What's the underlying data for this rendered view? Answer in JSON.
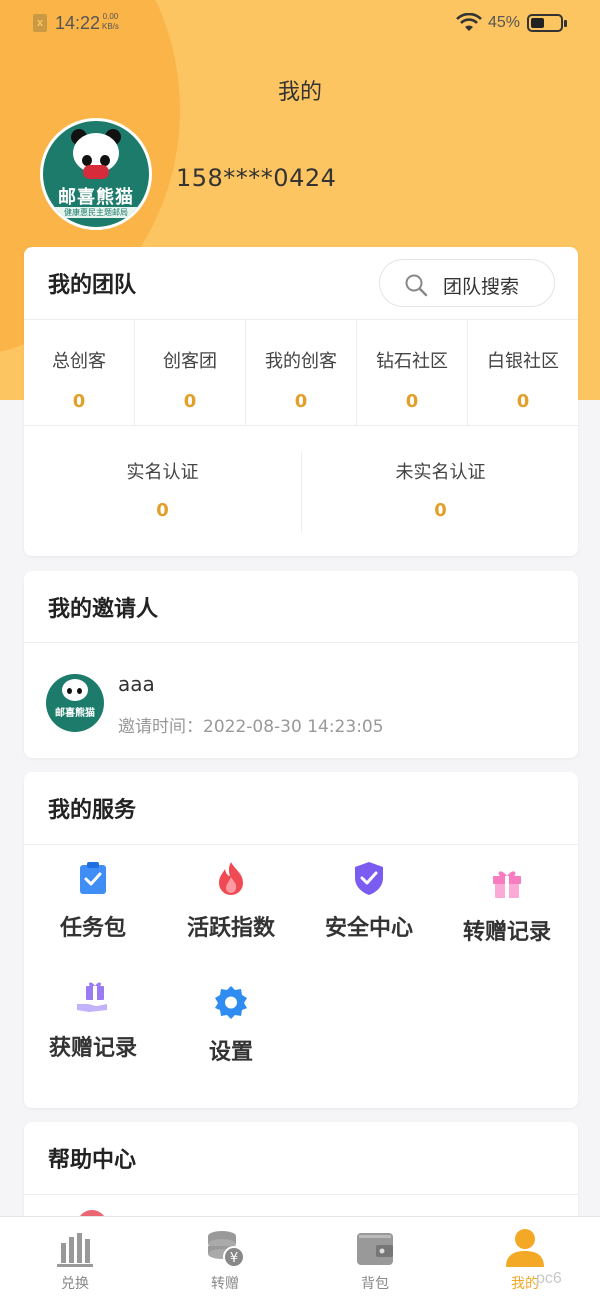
{
  "status_bar": {
    "time": "14:22",
    "speed_value": "0.00",
    "speed_unit": "KB/s",
    "battery": "45%",
    "battery_level": 0.45
  },
  "header": {
    "title": "我的",
    "phone": "158****0424"
  },
  "logo": {
    "name": "邮喜熊猫",
    "tagline": "健康惠民主题邮局",
    "badge": "SCENE"
  },
  "team": {
    "title": "我的团队",
    "search_label": "团队搜索",
    "stats": [
      {
        "label": "总创客",
        "value": "0"
      },
      {
        "label": "创客团",
        "value": "0"
      },
      {
        "label": "我的创客",
        "value": "0"
      },
      {
        "label": "钻石社区",
        "value": "0"
      },
      {
        "label": "白银社区",
        "value": "0"
      }
    ],
    "verify": [
      {
        "label": "实名认证",
        "value": "0"
      },
      {
        "label": "未实名认证",
        "value": "0"
      }
    ]
  },
  "inviter": {
    "title": "我的邀请人",
    "name": "aaa",
    "time": "邀请时间：2022-08-30 14:23:05"
  },
  "services": {
    "title": "我的服务",
    "items": [
      {
        "label": "任务包",
        "icon": "clipboard-icon"
      },
      {
        "label": "活跃指数",
        "icon": "fire-icon"
      },
      {
        "label": "安全中心",
        "icon": "shield-icon"
      },
      {
        "label": "转赠记录",
        "icon": "gift-icon"
      },
      {
        "label": "获赠记录",
        "icon": "gift-hand-icon"
      },
      {
        "label": "设置",
        "icon": "gear-icon"
      }
    ]
  },
  "help": {
    "title": "帮助中心"
  },
  "tabbar": {
    "items": [
      {
        "label": "兑换",
        "icon": "bar-chart-icon"
      },
      {
        "label": "转赠",
        "icon": "coins-icon"
      },
      {
        "label": "背包",
        "icon": "wallet-icon"
      },
      {
        "label": "我的",
        "icon": "user-icon"
      }
    ],
    "active_index": 3
  },
  "watermark": "pc6",
  "colors": {
    "accent": "#fdc561",
    "accent_dark": "#fbb447",
    "number": "#e2a02a",
    "active_tab": "#f3a826"
  }
}
